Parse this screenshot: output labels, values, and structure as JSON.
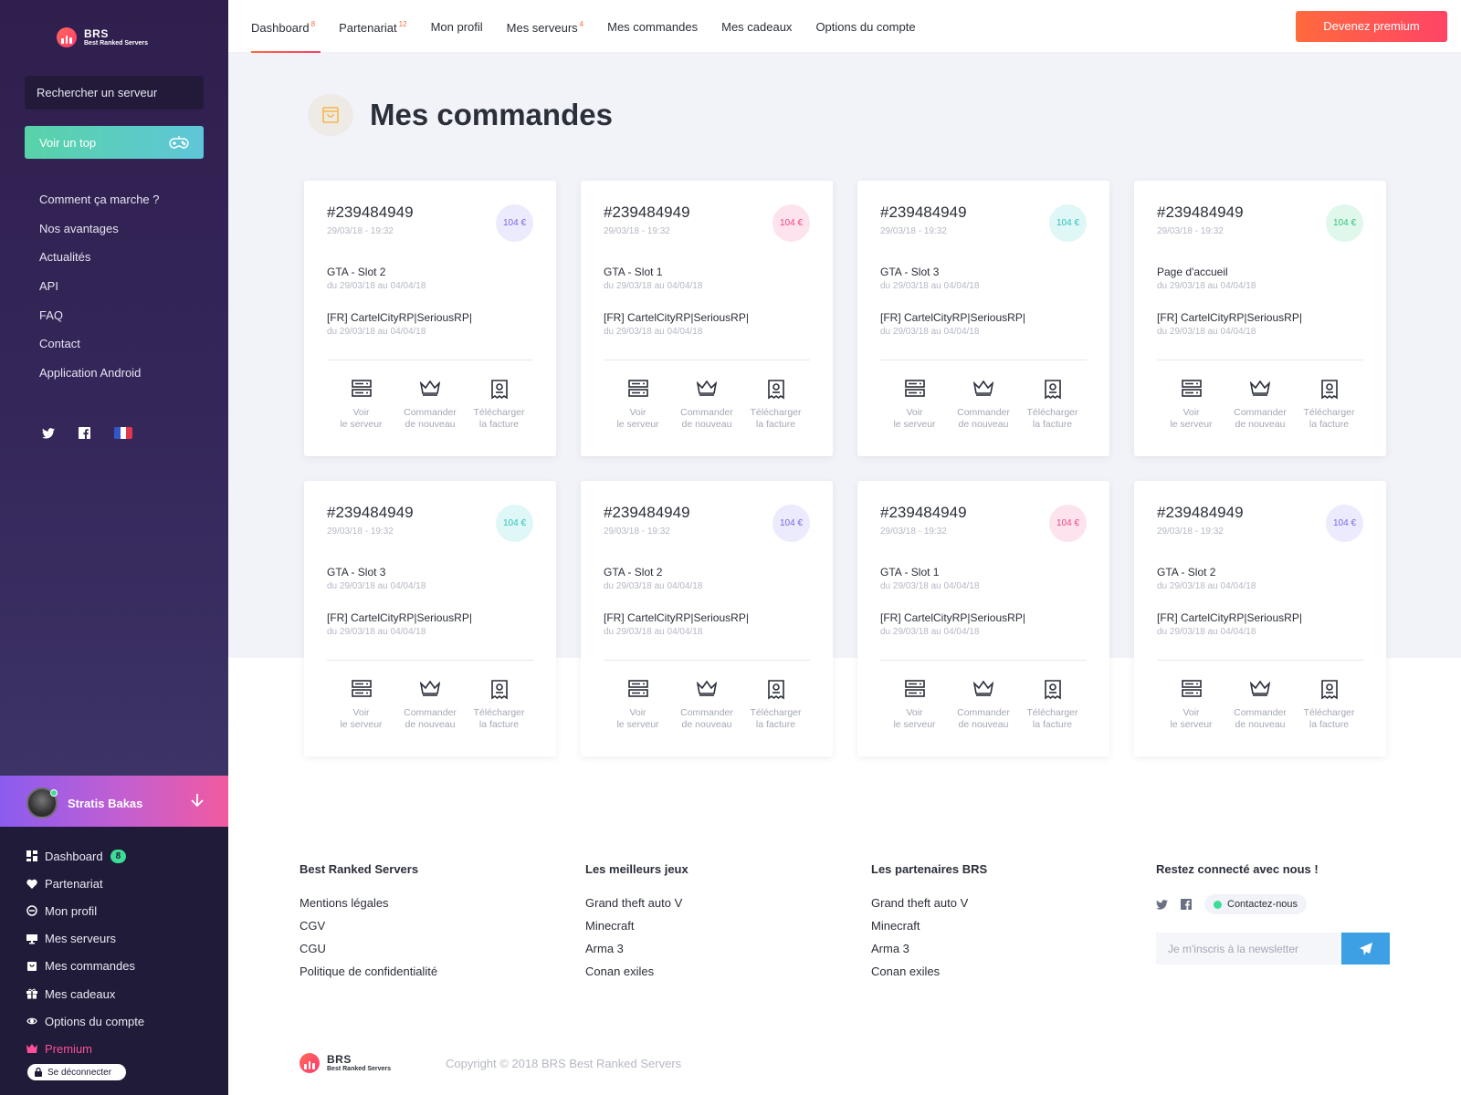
{
  "brand": {
    "name": "BRS",
    "tagline": "Best Ranked Servers"
  },
  "sidebar": {
    "search_label": "Rechercher un serveur",
    "top_button": "Voir un top",
    "nav": [
      "Comment ça marche ?",
      "Nos avantages",
      "Actualités",
      "API",
      "FAQ",
      "Contact",
      "Application Android"
    ],
    "socials": [
      "twitter-icon",
      "facebook-icon",
      "france-flag-icon"
    ],
    "user": {
      "name": "Stratis Bakas",
      "status": "online"
    },
    "bottom_nav": [
      {
        "label": "Dashboard",
        "icon": "dashboard-icon",
        "badge": "8"
      },
      {
        "label": "Partenariat",
        "icon": "heart-icon"
      },
      {
        "label": "Mon profil",
        "icon": "profile-icon"
      },
      {
        "label": "Mes serveurs",
        "icon": "monitor-icon"
      },
      {
        "label": "Mes commandes",
        "icon": "bag-icon"
      },
      {
        "label": "Mes cadeaux",
        "icon": "gift-icon"
      },
      {
        "label": "Options du compte",
        "icon": "eye-icon"
      },
      {
        "label": "Premium",
        "icon": "crown-icon"
      }
    ],
    "logout": "Se déconnecter"
  },
  "topbar": {
    "tabs": [
      {
        "label": "Dashboard",
        "count": "8",
        "active": true
      },
      {
        "label": "Partenariat",
        "count": "12"
      },
      {
        "label": "Mon profil",
        "count": ""
      },
      {
        "label": "Mes serveurs",
        "count": "4"
      },
      {
        "label": "Mes commandes",
        "count": ""
      },
      {
        "label": "Mes cadeaux",
        "count": ""
      },
      {
        "label": "Options du compte",
        "count": ""
      }
    ],
    "premium_button": "Devenez premium"
  },
  "page": {
    "title": "Mes commandes",
    "icon": "bag-icon"
  },
  "order_actions": [
    {
      "line1": "Voir",
      "line2": "le serveur",
      "icon": "server-icon"
    },
    {
      "line1": "Commander",
      "line2": "de nouveau",
      "icon": "crown-icon"
    },
    {
      "line1": "Télécharger",
      "line2": "la facture",
      "icon": "invoice-icon"
    }
  ],
  "orders": [
    {
      "id": "#239484949",
      "date": "29/03/18 - 19:32",
      "price": "104 €",
      "price_color": "purple",
      "product": "GTA - Slot 2",
      "product_period": "du 29/03/18 au 04/04/18",
      "server": "[FR] CartelCityRP|SeriousRP|",
      "server_period": "du 29/03/18 au 04/04/18"
    },
    {
      "id": "#239484949",
      "date": "29/03/18 - 19:32",
      "price": "104 €",
      "price_color": "pink",
      "product": "GTA - Slot 1",
      "product_period": "du 29/03/18 au 04/04/18",
      "server": "[FR] CartelCityRP|SeriousRP|",
      "server_period": "du 29/03/18 au 04/04/18"
    },
    {
      "id": "#239484949",
      "date": "29/03/18 - 19:32",
      "price": "104 €",
      "price_color": "teal",
      "product": "GTA - Slot 3",
      "product_period": "du 29/03/18 au 04/04/18",
      "server": "[FR] CartelCityRP|SeriousRP|",
      "server_period": "du 29/03/18 au 04/04/18"
    },
    {
      "id": "#239484949",
      "date": "29/03/18 - 19:32",
      "price": "104 €",
      "price_color": "green",
      "product": "Page d'accueil",
      "product_period": "du 29/03/18 au 04/04/18",
      "server": "[FR] CartelCityRP|SeriousRP|",
      "server_period": "du 29/03/18 au 04/04/18"
    },
    {
      "id": "#239484949",
      "date": "29/03/18 - 19:32",
      "price": "104 €",
      "price_color": "teal",
      "product": "GTA - Slot 3",
      "product_period": "du 29/03/18 au 04/04/18",
      "server": "[FR] CartelCityRP|SeriousRP|",
      "server_period": "du 29/03/18 au 04/04/18"
    },
    {
      "id": "#239484949",
      "date": "29/03/18 - 19:32",
      "price": "104 €",
      "price_color": "purple",
      "product": "GTA - Slot 2",
      "product_period": "du 29/03/18 au 04/04/18",
      "server": "[FR] CartelCityRP|SeriousRP|",
      "server_period": "du 29/03/18 au 04/04/18"
    },
    {
      "id": "#239484949",
      "date": "29/03/18 - 19:32",
      "price": "104 €",
      "price_color": "pink",
      "product": "GTA - Slot 1",
      "product_period": "du 29/03/18 au 04/04/18",
      "server": "[FR] CartelCityRP|SeriousRP|",
      "server_period": "du 29/03/18 au 04/04/18"
    },
    {
      "id": "#239484949",
      "date": "29/03/18 - 19:32",
      "price": "104 €",
      "price_color": "purple",
      "product": "GTA - Slot 2",
      "product_period": "du 29/03/18 au 04/04/18",
      "server": "[FR] CartelCityRP|SeriousRP|",
      "server_period": "du 29/03/18 au 04/04/18"
    }
  ],
  "price_colors": {
    "purple": {
      "bg": "#ecebfd",
      "fg": "#7866e8"
    },
    "pink": {
      "bg": "#fde3ee",
      "fg": "#f2457f"
    },
    "teal": {
      "bg": "#dff7f6",
      "fg": "#2cc3bd"
    },
    "green": {
      "bg": "#e0f8ec",
      "fg": "#31c27c"
    }
  },
  "footer": {
    "columns": [
      {
        "title": "Best Ranked Servers",
        "links": [
          "Mentions légales",
          "CGV",
          "CGU",
          "Politique de confidentialité"
        ]
      },
      {
        "title": "Les meilleurs jeux",
        "links": [
          "Grand theft auto V",
          "Minecraft",
          "Arma 3",
          "Conan exiles"
        ]
      },
      {
        "title": "Les partenaires BRS",
        "links": [
          "Grand theft auto V",
          "Minecraft",
          "Arma 3",
          "Conan exiles"
        ]
      }
    ],
    "connect_title": "Restez connecté avec nous !",
    "contact_label": "Contactez-nous",
    "newsletter_placeholder": "Je m'inscris à la newsletter",
    "copyright": "Copyright © 2018 BRS Best Ranked Servers"
  },
  "colors": {
    "accent": "#ff5a4a",
    "sidebar": "#2f1f4e",
    "success": "#3ddc97",
    "send_button": "#3ea0e4"
  }
}
